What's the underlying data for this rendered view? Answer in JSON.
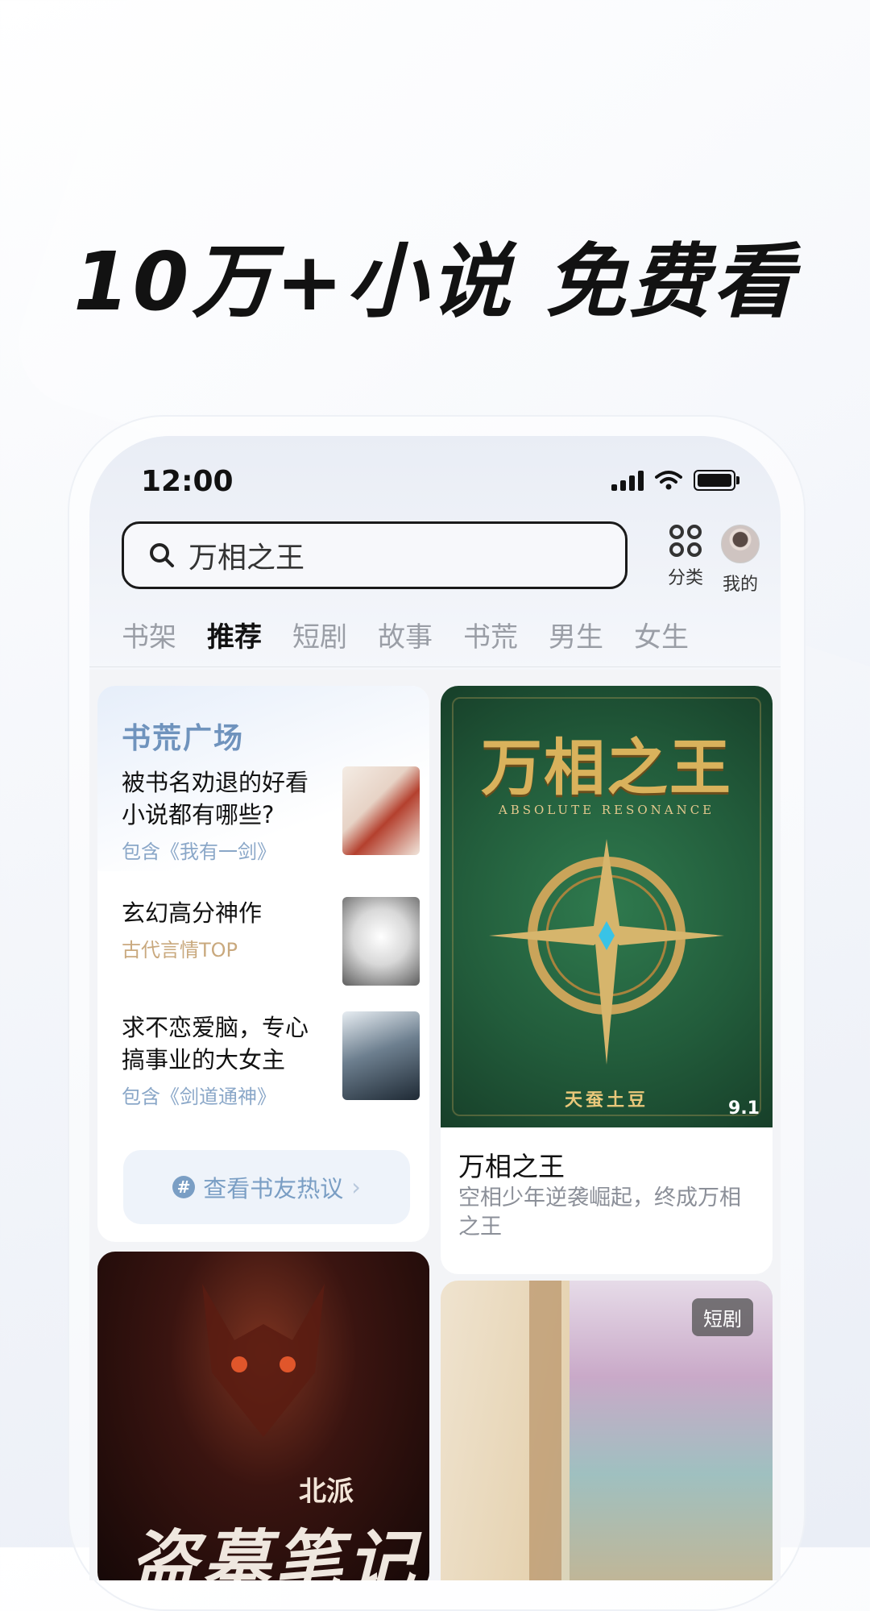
{
  "headline": "10万+小说 免费看",
  "status": {
    "time": "12:00"
  },
  "search": {
    "text": "万相之王"
  },
  "category_label": "分类",
  "me_label": "我的",
  "tabs": [
    "书架",
    "推荐",
    "短剧",
    "故事",
    "书荒",
    "男生",
    "女生"
  ],
  "active_tab": "推荐",
  "book_square": {
    "title": "书荒广场",
    "topics": [
      {
        "title": "被书名劝退的好看小说都有哪些?",
        "sub": "包含《我有一剑》",
        "sub_color": "#8aa7c8"
      },
      {
        "title": "玄幻高分神作",
        "sub": "古代言情TOP",
        "sub_color": "#c9a97e"
      },
      {
        "title": "求不恋爱脑，专心搞事业的大女主",
        "sub": "包含《剑道通神》",
        "sub_color": "#8aa7c8"
      }
    ],
    "hot_button": "查看书友热议"
  },
  "featured_book": {
    "cover_title": "万相之王",
    "cover_subtitle": "ABSOLUTE RESONANCE",
    "cover_author": "天蚕土豆",
    "score": "9.1",
    "title": "万相之王",
    "desc": "空相少年逆袭崛起，终成万相之王"
  },
  "bottom_left_cover": {
    "tag": "北派",
    "title": "盗墓笔记"
  },
  "bottom_right_cover": {
    "tag": "短剧"
  }
}
